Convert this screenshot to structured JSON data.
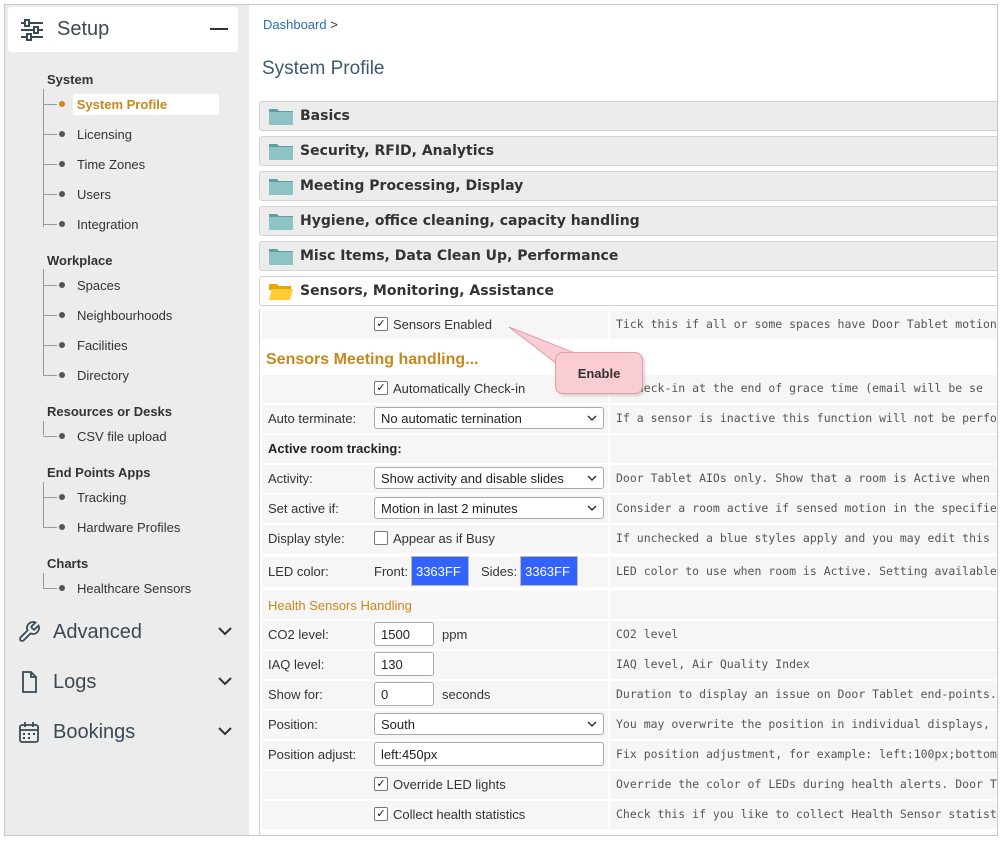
{
  "sidebar": {
    "setup_title": "Setup",
    "groups": [
      {
        "title": "System",
        "items": [
          "System Profile",
          "Licensing",
          "Time Zones",
          "Users",
          "Integration"
        ]
      },
      {
        "title": "Workplace",
        "items": [
          "Spaces",
          "Neighbourhoods",
          "Facilities",
          "Directory"
        ]
      },
      {
        "title": "Resources or Desks",
        "items": [
          "CSV file upload"
        ]
      },
      {
        "title": "End Points Apps",
        "items": [
          "Tracking",
          "Hardware Profiles"
        ]
      },
      {
        "title": "Charts",
        "items": [
          "Healthcare Sensors"
        ]
      }
    ],
    "sections": [
      "Advanced",
      "Logs",
      "Bookings"
    ]
  },
  "breadcrumb": {
    "link": "Dashboard",
    "sep": ">"
  },
  "page_title": "System Profile",
  "panels": [
    "Basics",
    "Security, RFID, Analytics",
    "Meeting Processing, Display",
    "Hygiene, office cleaning, capacity handling",
    "Misc Items, Data Clean Up, Performance",
    "Sensors, Monitoring, Assistance"
  ],
  "form": {
    "sensors_enabled": {
      "label": "Sensors Enabled",
      "checked": true,
      "desc": "Tick this if all or some spaces have Door Tablet motion"
    },
    "meeting_handling_title": "Sensors Meeting handling...",
    "auto_checkin": {
      "label": "Automatically Check-in",
      "checked": true,
      "desc": "o check-in at the end of grace time (email will be se"
    },
    "auto_terminate": {
      "label": "Auto terminate:",
      "value": "No automatic ternination",
      "desc": "If a sensor is inactive this function will not be perfor"
    },
    "active_tracking_title": "Active room tracking:",
    "activity": {
      "label": "Activity:",
      "value": "Show activity and disable slides",
      "desc": "Door Tablet AIOs only. Show that a room is Active when n"
    },
    "set_active": {
      "label": "Set active if:",
      "value": "Motion in last 2 minutes",
      "desc": "Consider a room active if sensed motion in the specified"
    },
    "display_style": {
      "label": "Display style:",
      "checkbox_label": "Appear as if Busy",
      "checked": false,
      "desc": "If unchecked a blue styles apply and you may edit this i"
    },
    "led_color": {
      "label": "LED color:",
      "front_label": "Front:",
      "front_value": "3363FF",
      "sides_label": "Sides:",
      "sides_value": "3363FF",
      "color": "#3363ff",
      "desc": "LED color to use when room is Active. Setting available"
    },
    "health_title": "Health Sensors Handling",
    "co2": {
      "label": "CO2 level:",
      "value": "1500",
      "unit": "ppm",
      "desc": "CO2 level"
    },
    "iaq": {
      "label": "IAQ level:",
      "value": "130",
      "desc": "IAQ level, Air Quality Index"
    },
    "show_for": {
      "label": "Show for:",
      "value": "0",
      "unit": "seconds",
      "desc": "Duration to display an issue on Door Tablet end-points."
    },
    "position": {
      "label": "Position:",
      "value": "South",
      "desc": "You may overwrite the position in individual displays, o"
    },
    "position_adjust": {
      "label": "Position adjust:",
      "value": "left:450px",
      "desc": "Fix position adjustment, for example: left:100px;bottom"
    },
    "override_led": {
      "label": "Override LED lights",
      "checked": true,
      "desc": "Override the color of LEDs during health alerts.  Door T"
    },
    "collect_stats": {
      "label": "Collect health statistics",
      "checked": true,
      "desc": "Check this if you like to collect Health Sensor statisti"
    }
  },
  "callout": {
    "text": "Enable"
  },
  "colors": {
    "accent": "#c8871c",
    "link": "#2a6bb4",
    "led": "#3363ff",
    "callout": "#f9cdd3"
  }
}
